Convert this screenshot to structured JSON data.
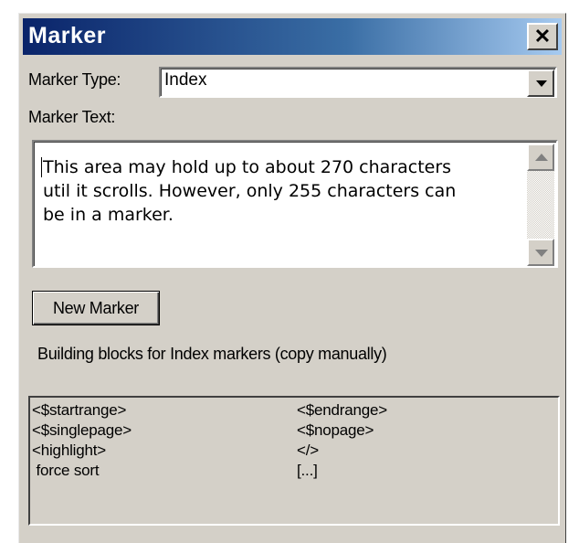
{
  "window": {
    "title": "Marker",
    "close_symbol": "✕"
  },
  "marker_type": {
    "label": "Marker Type:",
    "selected": "Index"
  },
  "marker_text": {
    "label": "Marker Text:",
    "value": "This area may hold up to about 270 characters util it scrolls. However, only 255 characters can be in a marker."
  },
  "new_marker_button": "New Marker",
  "building_blocks_label": "Building blocks for Index markers (copy manually)",
  "building_blocks": [
    [
      "<$startrange>",
      "<$endrange>"
    ],
    [
      "<$singlepage>",
      "<$nopage>"
    ],
    [
      "<highlight>",
      "</>"
    ],
    [
      " force sort",
      "[...]"
    ]
  ]
}
